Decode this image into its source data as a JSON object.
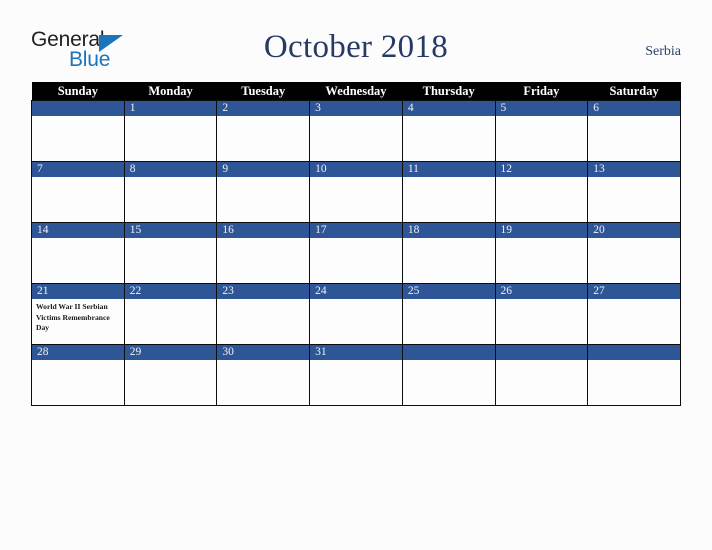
{
  "brand": {
    "name_part1": "General",
    "name_part2": "Blue",
    "triangle_icon": "triangle-icon",
    "accent_blue": "#1b75bc"
  },
  "header": {
    "title": "October 2018",
    "region": "Serbia"
  },
  "colors": {
    "header_row_bg": "#010101",
    "day_number_bg": "#2e5596",
    "day_number_text": "#f0f2f7",
    "title_text": "#263a63",
    "page_bg": "#fcfcfc",
    "cell_bg": "#fdfdfd",
    "grid_line": "#0d0d0d"
  },
  "calendar": {
    "weekday_headers": [
      "Sunday",
      "Monday",
      "Tuesday",
      "Wednesday",
      "Thursday",
      "Friday",
      "Saturday"
    ],
    "weeks": [
      [
        {
          "day": "",
          "events": []
        },
        {
          "day": "1",
          "events": []
        },
        {
          "day": "2",
          "events": []
        },
        {
          "day": "3",
          "events": []
        },
        {
          "day": "4",
          "events": []
        },
        {
          "day": "5",
          "events": []
        },
        {
          "day": "6",
          "events": []
        }
      ],
      [
        {
          "day": "7",
          "events": []
        },
        {
          "day": "8",
          "events": []
        },
        {
          "day": "9",
          "events": []
        },
        {
          "day": "10",
          "events": []
        },
        {
          "day": "11",
          "events": []
        },
        {
          "day": "12",
          "events": []
        },
        {
          "day": "13",
          "events": []
        }
      ],
      [
        {
          "day": "14",
          "events": []
        },
        {
          "day": "15",
          "events": []
        },
        {
          "day": "16",
          "events": []
        },
        {
          "day": "17",
          "events": []
        },
        {
          "day": "18",
          "events": []
        },
        {
          "day": "19",
          "events": []
        },
        {
          "day": "20",
          "events": []
        }
      ],
      [
        {
          "day": "21",
          "events": [
            "World War II Serbian Victims Remembrance Day"
          ]
        },
        {
          "day": "22",
          "events": []
        },
        {
          "day": "23",
          "events": []
        },
        {
          "day": "24",
          "events": []
        },
        {
          "day": "25",
          "events": []
        },
        {
          "day": "26",
          "events": []
        },
        {
          "day": "27",
          "events": []
        }
      ],
      [
        {
          "day": "28",
          "events": []
        },
        {
          "day": "29",
          "events": []
        },
        {
          "day": "30",
          "events": []
        },
        {
          "day": "31",
          "events": []
        },
        {
          "day": "",
          "events": []
        },
        {
          "day": "",
          "events": []
        },
        {
          "day": "",
          "events": []
        }
      ]
    ]
  }
}
